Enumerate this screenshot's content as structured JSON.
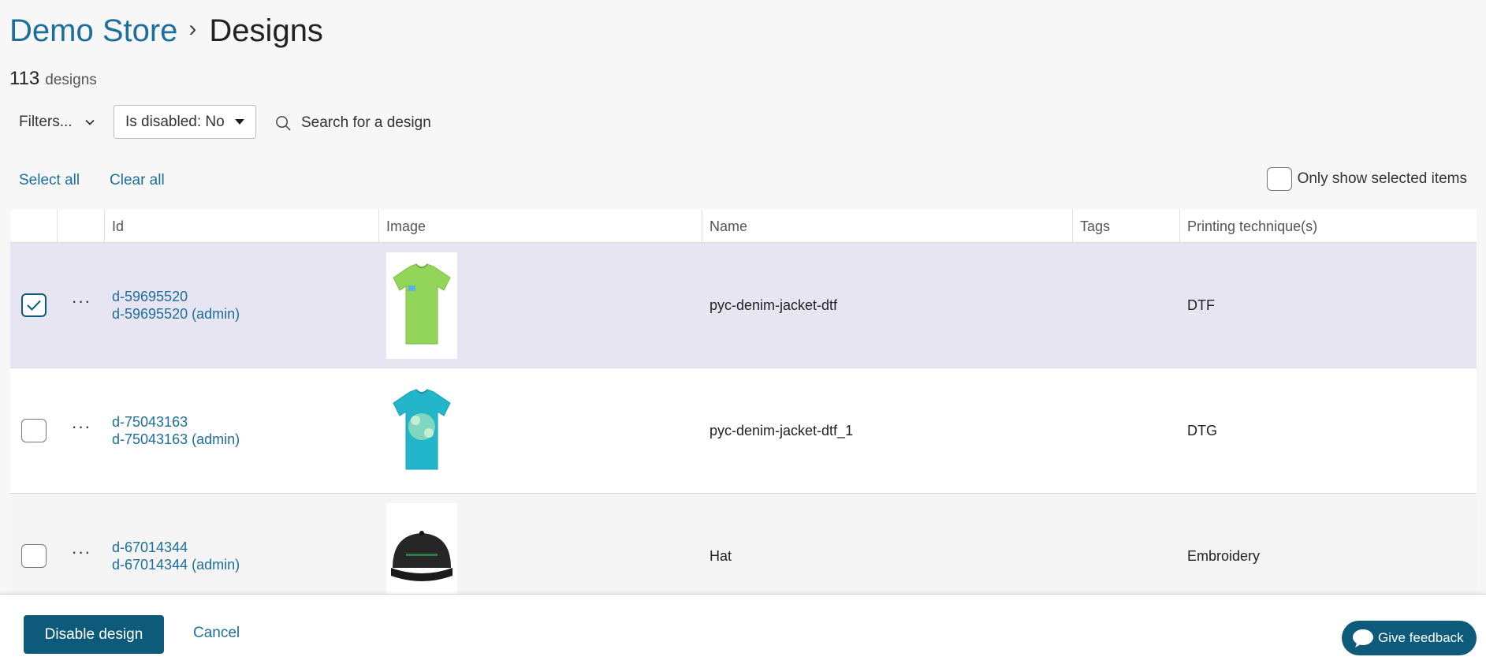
{
  "breadcrumb": {
    "store": "Demo Store",
    "separator": "›",
    "page": "Designs"
  },
  "count": {
    "number": "113",
    "label": "designs"
  },
  "filters": {
    "filters_label": "Filters...",
    "is_disabled_label": "Is disabled: No",
    "search_placeholder": "Search for a design"
  },
  "selection": {
    "select_all": "Select all",
    "clear_all": "Clear all",
    "only_selected": "Only show selected items"
  },
  "table": {
    "columns": [
      "Id",
      "Image",
      "Name",
      "Tags",
      "Printing technique(s)"
    ],
    "rows": [
      {
        "selected": true,
        "id": "d-59695520",
        "admin_id": "d-59695520 (admin)",
        "image": "green-tshirt",
        "name": "pyc-denim-jacket-dtf",
        "tags": "",
        "technique": "DTF"
      },
      {
        "selected": false,
        "id": "d-75043163",
        "admin_id": "d-75043163 (admin)",
        "image": "teal-tshirt",
        "name": "pyc-denim-jacket-dtf_1",
        "tags": "",
        "technique": "DTG"
      },
      {
        "selected": false,
        "id": "d-67014344",
        "admin_id": "d-67014344 (admin)",
        "image": "black-hat",
        "name": "Hat",
        "tags": "",
        "technique": "Embroidery"
      }
    ]
  },
  "actions": {
    "disable_label": "Disable design",
    "cancel_label": "Cancel",
    "feedback_label": "Give feedback"
  },
  "colors": {
    "accent": "#1c6e9c",
    "primary": "#0d5a7a",
    "selected_row": "#e8e5f3"
  }
}
